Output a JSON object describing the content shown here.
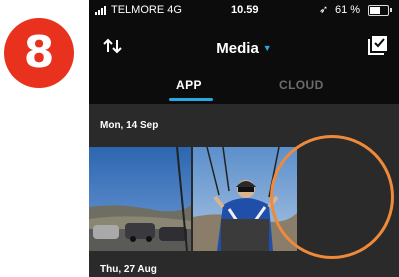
{
  "annotation": {
    "step_number": "8",
    "badge_color": "#e8321e",
    "highlight_color": "#ef8a3a"
  },
  "status_bar": {
    "carrier": "TELMORE",
    "network": "4G",
    "time": "10.59",
    "battery_percent": "61 %",
    "battery_level": 0.61
  },
  "header": {
    "title": "Media",
    "sort_icon": "sort-arrows-icon",
    "select_icon": "checkbox-select-icon"
  },
  "tabs": [
    {
      "label": "APP",
      "active": true
    },
    {
      "label": "CLOUD",
      "active": false
    }
  ],
  "media": {
    "groups": [
      {
        "date": "Mon, 14 Sep"
      },
      {
        "date": "Thu, 27 Aug"
      }
    ]
  },
  "colors": {
    "accent": "#2aa6e0",
    "background": "#0c0c0c",
    "content_bg": "#2a2a2a"
  }
}
